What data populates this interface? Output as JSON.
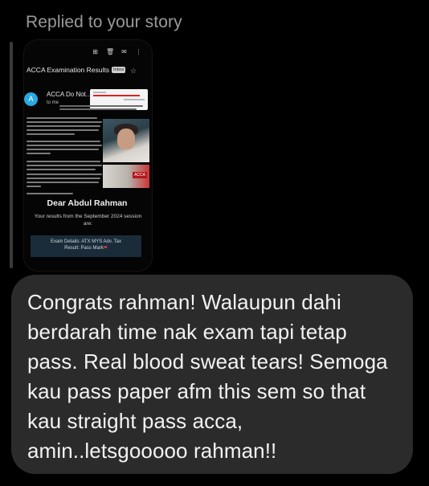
{
  "header": {
    "replied_label": "Replied to your story"
  },
  "story": {
    "email_subject": "ACCA Examination Results",
    "inbox_tag": "Inbox",
    "sender_name": "ACCA Do Not...",
    "sender_initial": "A",
    "to_label": "to me",
    "greeting": "Dear Abdul Rahman",
    "results_text": "Your results from the September 2024 session are:",
    "exam_details_line1": "Exam Details: ATX MYS Adv. Tax",
    "exam_details_line2": "Result: Pass Mark",
    "toolbar_icons": [
      "archive-icon",
      "delete-icon",
      "mail-icon",
      "more-icon"
    ],
    "photo_badge": "ACCA"
  },
  "message": {
    "text": "Congrats rahman! Walaupun dahi berdarah time nak exam tapi tetap pass. Real blood sweat tears! Semoga kau pass paper afm this sem so that kau straight pass acca, amin..letsgooooo rahman!!"
  },
  "colors": {
    "background": "#000000",
    "bubble": "#2b2b2b",
    "label": "#9a9a9a",
    "avatar": "#2aa9e0",
    "exam_box": "#1a2c39"
  }
}
